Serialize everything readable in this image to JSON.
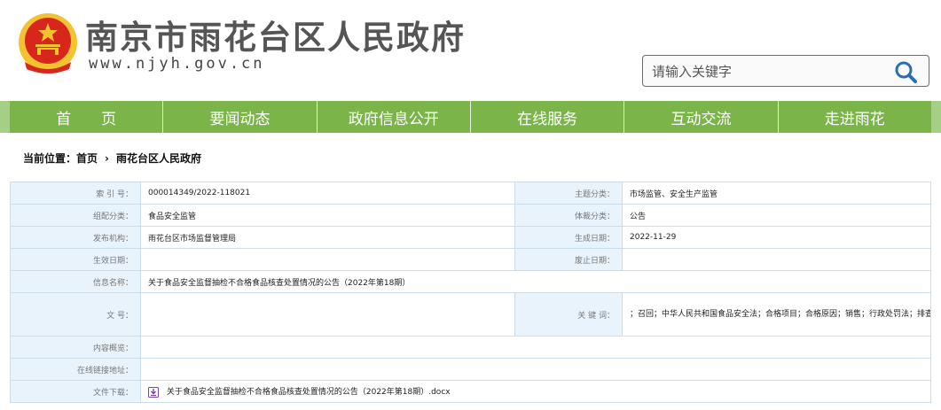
{
  "header": {
    "site_title": "南京市雨花台区人民政府",
    "site_url": "www.njyh.gov.cn",
    "search_placeholder": "请输入关键字"
  },
  "nav": {
    "items": [
      "首　　页",
      "要闻动态",
      "政府信息公开",
      "在线服务",
      "互动交流",
      "走进雨花"
    ]
  },
  "breadcrumb": {
    "prefix": "当前位置：",
    "home": "首页",
    "separator": "›",
    "current": "雨花台区人民政府"
  },
  "info": {
    "index_label": "索  引  号：",
    "index_value": "000014349/2022-118021",
    "topic_label": "主题分类：",
    "topic_value": "市场监管、安全生产监管",
    "category_label": "组配分类：",
    "category_value": "食品安全监管",
    "genre_label": "体裁分类：",
    "genre_value": "公告",
    "publisher_label": "发布机构：",
    "publisher_value": "雨花台区市场监督管理局",
    "created_label": "生成日期：",
    "created_value": "2022-11-29",
    "effective_label": "生效日期：",
    "effective_value": "",
    "abolish_label": "废止日期：",
    "abolish_value": "",
    "name_label": "信息名称：",
    "name_value": "关于食品安全监督抽检不合格食品核查处置情况的公告（2022年第18期）",
    "docno_label": "文      号：",
    "docno_value": "",
    "keywords_label": "关  键  词：",
    "keywords_value": "；召回；中华人民共和国食品安全法；合格项目；合格原因；销售；行政处罚法；排查；货值；食用",
    "summary_label": "内容概览：",
    "summary_value": "",
    "link_label": "在线链接地址：",
    "link_value": "",
    "download_label": "文件下载：",
    "download_value": "关于食品安全监督抽检不合格食品核查处置情况的公告（2022年第18期）.docx"
  },
  "colors": {
    "nav_green": "#7bb54a",
    "label_bg": "#e9f3fb",
    "border": "#cbdcea",
    "emblem_red": "#d7261b",
    "emblem_gold": "#f2c230"
  }
}
